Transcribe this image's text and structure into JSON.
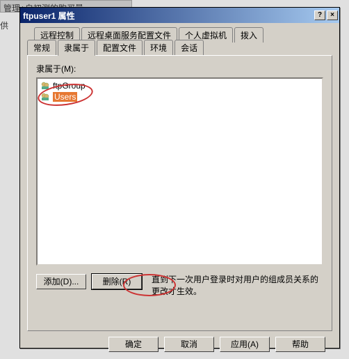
{
  "behind_title": "管理+自初测的购买量",
  "behind_label": "供",
  "window": {
    "title": "ftpuser1 属性",
    "help_btn": "?",
    "close_btn": "×"
  },
  "tabs": {
    "row1": [
      "远程控制",
      "远程桌面服务配置文件",
      "个人虚拟机",
      "拨入"
    ],
    "row2": [
      "常规",
      "隶属于",
      "配置文件",
      "环境",
      "会话"
    ],
    "active": "隶属于"
  },
  "panel": {
    "list_label": "隶属于(M):",
    "groups": [
      {
        "name": "ftpGroup",
        "selected": false
      },
      {
        "name": "Users",
        "selected": true
      }
    ],
    "add_btn": "添加(D)...",
    "remove_btn": "删除(R)",
    "note": "直到下一次用户登录时对用户的组成员关系的更改才生效。"
  },
  "footer": {
    "ok": "确定",
    "cancel": "取消",
    "apply": "应用(A)",
    "help": "帮助"
  }
}
